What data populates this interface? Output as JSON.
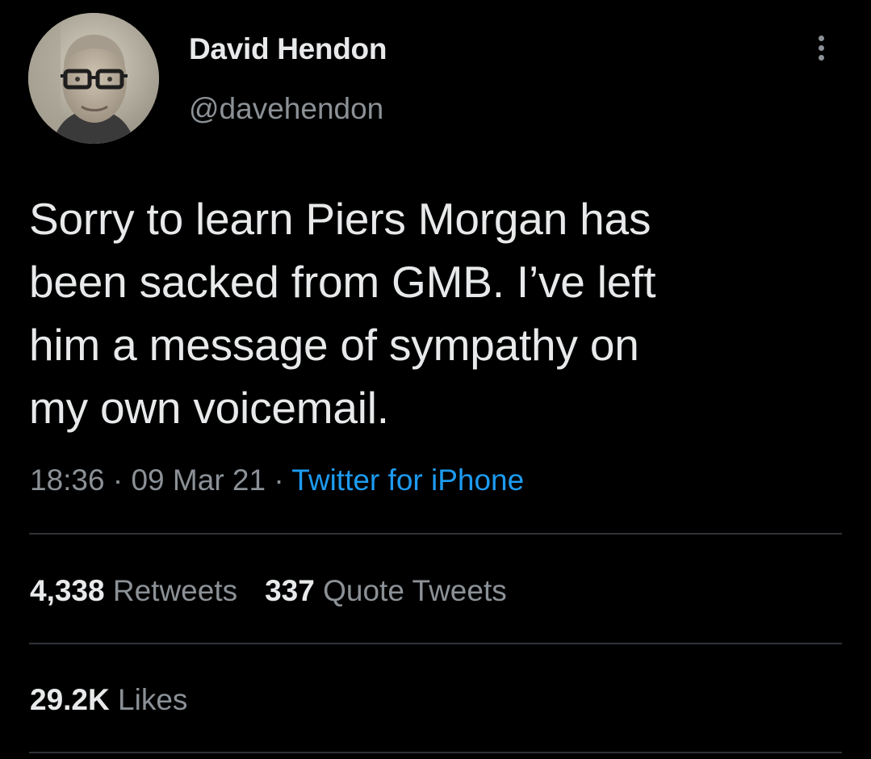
{
  "user": {
    "display_name": "David Hendon",
    "handle": "@davehendon"
  },
  "tweet": {
    "lines": [
      "Sorry to learn Piers Morgan has",
      "been sacked from GMB. I’ve left",
      "him a message of sympathy on",
      "my own voicemail."
    ],
    "time": "18:36",
    "date": "09 Mar 21",
    "separator": " · ",
    "source": "Twitter for iPhone"
  },
  "stats": {
    "retweets_count": "4,338",
    "retweets_label": "Retweets",
    "quotes_count": "337",
    "quotes_label": "Quote Tweets",
    "likes_count": "29.2K",
    "likes_label": "Likes"
  },
  "icons": {
    "more": "more-vertical-icon",
    "avatar": "profile-photo"
  },
  "colors": {
    "background": "#000000",
    "text": "#e7e9ea",
    "secondary": "#8b9196",
    "link": "#1d9bf0",
    "divider": "#2f3336"
  }
}
